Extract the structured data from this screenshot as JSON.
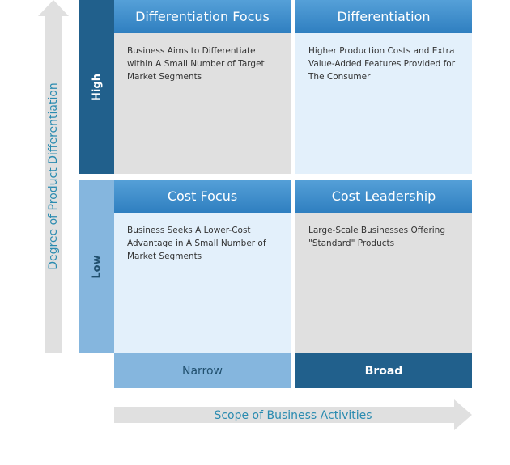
{
  "y_axis": {
    "label": "Degree of Product Differentiation"
  },
  "x_axis": {
    "label": "Scope of Business Activities"
  },
  "rows": [
    {
      "label": "High"
    },
    {
      "label": "Low"
    }
  ],
  "columns": [
    {
      "label": "Narrow"
    },
    {
      "label": "Broad"
    }
  ],
  "cells": [
    {
      "title": "Differentiation Focus",
      "text": "Business Aims to Differentiate within A Small Number of Target Market Segments"
    },
    {
      "title": "Differentiation",
      "text": "Higher Production Costs and Extra Value-Added Features Provided for The Consumer"
    },
    {
      "title": "Cost Focus",
      "text": "Business Seeks A Lower-Cost Advantage in A Small Number of Market Segments"
    },
    {
      "title": "Cost Leadership",
      "text": "Large-Scale Businesses Offering \"Standard\" Products"
    }
  ],
  "colors": {
    "dark_blue": "#21608c",
    "light_blue": "#85b6de",
    "header_blue": "#3a88c8",
    "gray": "#e0e0e0",
    "pale_blue": "#e3f0fb",
    "axis_text": "#2a8bb0"
  }
}
